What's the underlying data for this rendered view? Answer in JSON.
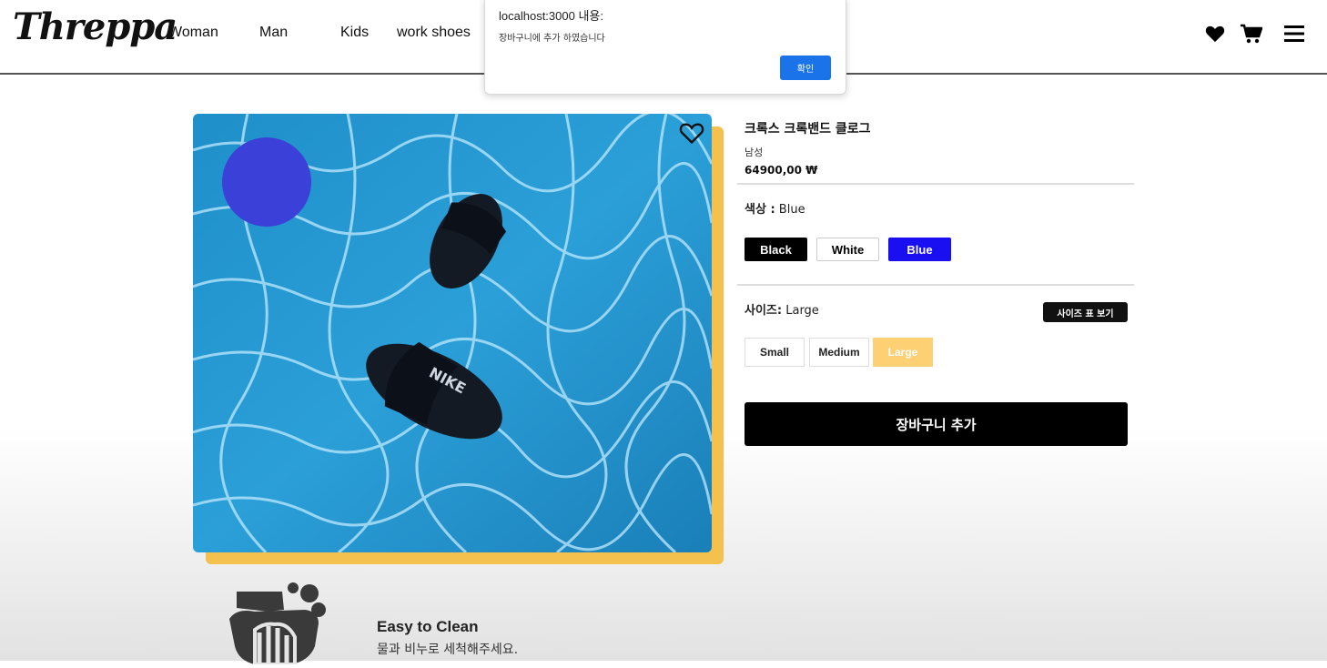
{
  "brand": {
    "logo": "Threppa"
  },
  "nav": [
    "Woman",
    "Man",
    "Kids",
    "work shoes"
  ],
  "header_icons": [
    "heart-icon",
    "cart-icon",
    "menu-icon"
  ],
  "alert": {
    "title": "localhost:3000 내용:",
    "message": "장바구니에 추가 하였습니다",
    "ok_label": "확인"
  },
  "product": {
    "name": "크록스 크록밴드 클로그",
    "gender": "남성",
    "price": "64900,00 ₩",
    "color_label": "색상 :",
    "color_value": "Blue",
    "colors": [
      {
        "label": "Black",
        "bg": "#000000",
        "fg": "#ffffff"
      },
      {
        "label": "White",
        "bg": "#ffffff",
        "fg": "#000000"
      },
      {
        "label": "Blue",
        "bg": "#1a0ff0",
        "fg": "#ffffff",
        "selected": true
      }
    ],
    "size_label": "사이즈:",
    "size_value": "Large",
    "size_chart_label": "사이즈 표 보기",
    "sizes": [
      {
        "label": "Small"
      },
      {
        "label": "Medium"
      },
      {
        "label": "Large",
        "selected": true
      }
    ],
    "add_to_cart_label": "장바구니 추가",
    "color_swatch": "#3a40d8"
  },
  "feature": {
    "title": "Easy to Clean",
    "desc": "물과 비누로 세척해주세요."
  },
  "colors": {
    "accent_yellow": "#f4c04e",
    "selected_size_bg": "#fcd073",
    "alert_button": "#1a73e8"
  }
}
